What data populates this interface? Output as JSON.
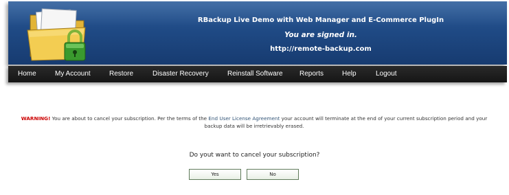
{
  "header": {
    "title": "RBackup Live Demo with Web Manager and E-Commerce PlugIn",
    "signed_in": "You are signed in.",
    "url": "http://remote-backup.com",
    "logo_icon": "folder-lock-icon"
  },
  "nav": {
    "items": [
      {
        "label": "Home"
      },
      {
        "label": "My Account"
      },
      {
        "label": "Restore"
      },
      {
        "label": "Disaster Recovery"
      },
      {
        "label": "Reinstall Software"
      },
      {
        "label": "Reports"
      },
      {
        "label": "Help"
      },
      {
        "label": "Logout"
      }
    ]
  },
  "content": {
    "warning_label": "WARNING!",
    "warning_pre": " You are about to cancel your subscription. Per the terms of the ",
    "eula_link": "End User License Agreement",
    "warning_post": " your account will terminate at the end of your current subscription period and your backup data will be irretrievably erased.",
    "question": "Do yout want to cancel your subscription?",
    "yes_label": "Yes",
    "no_label": "No"
  },
  "colors": {
    "header_blue": "#1f4a85",
    "nav_black": "#1a1a1a",
    "warning_red": "#cc0000",
    "link_blue": "#335577"
  }
}
